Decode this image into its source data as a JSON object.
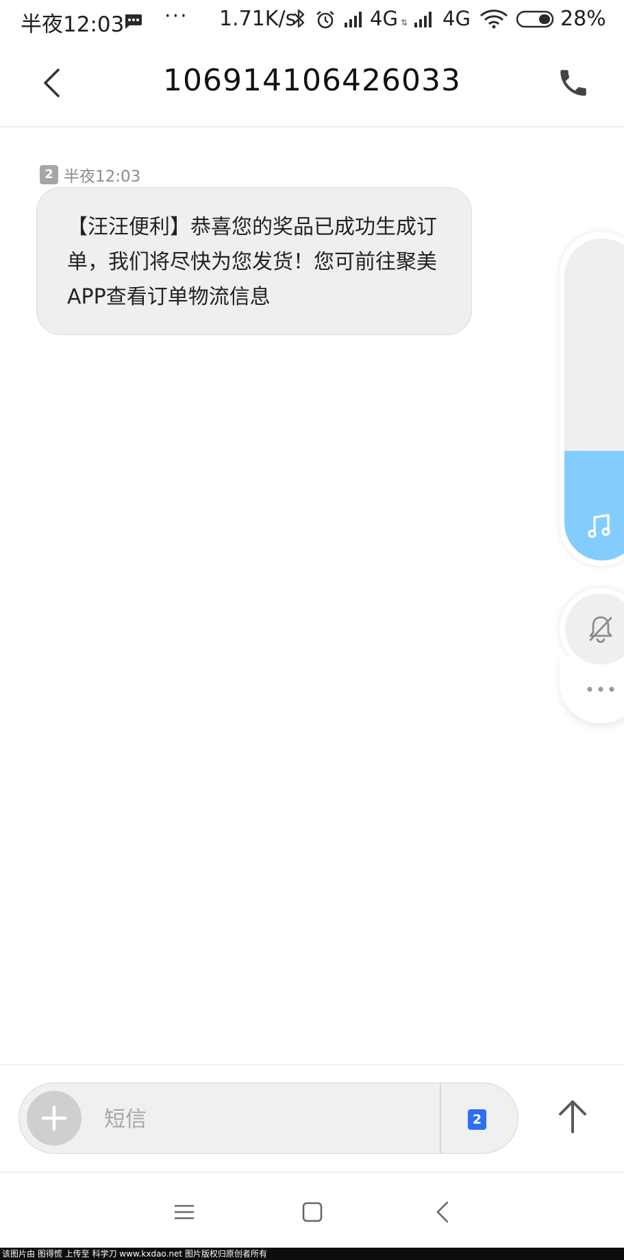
{
  "status_bar": {
    "time": "半夜12:03",
    "more_dots": "···",
    "net_speed": "1.71K/s",
    "network1": "4G",
    "network1_sub": "⇅",
    "network2": "4G",
    "battery": "28%",
    "icons": [
      "message-icon",
      "bluetooth-icon",
      "alarm-icon",
      "signal-icon",
      "signal-icon",
      "wifi-icon",
      "battery-icon"
    ]
  },
  "header": {
    "title": "106914106426033",
    "icons": [
      "back-chevron-icon",
      "phone-icon"
    ]
  },
  "message": {
    "sim": "2",
    "time": "半夜12:03",
    "text": "【汪汪便利】恭喜您的奖品已成功生成订单，我们将尽快为您发货！您可前往聚美APP查看订单物流信息"
  },
  "floating_controls": {
    "volume_level": 0.34,
    "volume_color": "#82cdfd",
    "icons": [
      "music-note-icon",
      "bell-mute-icon",
      "more-dots-icon"
    ]
  },
  "composer": {
    "placeholder": "短信",
    "sim": "2",
    "sim_color": "#2d6ff2",
    "icons": [
      "plus-icon",
      "send-arrow-up-icon"
    ]
  },
  "nav_bar": {
    "icons": [
      "menu-icon",
      "home-square-icon",
      "back-chevron-icon"
    ]
  },
  "watermark": {
    "text": "该图片由 图得慌 上传至 科学刀 www.kxdao.net 图片版权归原创者所有"
  }
}
